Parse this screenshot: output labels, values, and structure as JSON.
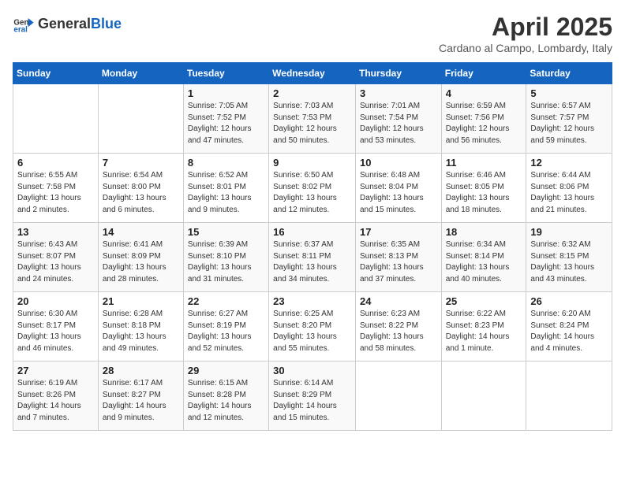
{
  "header": {
    "logo_general": "General",
    "logo_blue": "Blue",
    "title": "April 2025",
    "subtitle": "Cardano al Campo, Lombardy, Italy"
  },
  "weekdays": [
    "Sunday",
    "Monday",
    "Tuesday",
    "Wednesday",
    "Thursday",
    "Friday",
    "Saturday"
  ],
  "weeks": [
    [
      {
        "day": "",
        "info": ""
      },
      {
        "day": "",
        "info": ""
      },
      {
        "day": "1",
        "info": "Sunrise: 7:05 AM\nSunset: 7:52 PM\nDaylight: 12 hours and 47 minutes."
      },
      {
        "day": "2",
        "info": "Sunrise: 7:03 AM\nSunset: 7:53 PM\nDaylight: 12 hours and 50 minutes."
      },
      {
        "day": "3",
        "info": "Sunrise: 7:01 AM\nSunset: 7:54 PM\nDaylight: 12 hours and 53 minutes."
      },
      {
        "day": "4",
        "info": "Sunrise: 6:59 AM\nSunset: 7:56 PM\nDaylight: 12 hours and 56 minutes."
      },
      {
        "day": "5",
        "info": "Sunrise: 6:57 AM\nSunset: 7:57 PM\nDaylight: 12 hours and 59 minutes."
      }
    ],
    [
      {
        "day": "6",
        "info": "Sunrise: 6:55 AM\nSunset: 7:58 PM\nDaylight: 13 hours and 2 minutes."
      },
      {
        "day": "7",
        "info": "Sunrise: 6:54 AM\nSunset: 8:00 PM\nDaylight: 13 hours and 6 minutes."
      },
      {
        "day": "8",
        "info": "Sunrise: 6:52 AM\nSunset: 8:01 PM\nDaylight: 13 hours and 9 minutes."
      },
      {
        "day": "9",
        "info": "Sunrise: 6:50 AM\nSunset: 8:02 PM\nDaylight: 13 hours and 12 minutes."
      },
      {
        "day": "10",
        "info": "Sunrise: 6:48 AM\nSunset: 8:04 PM\nDaylight: 13 hours and 15 minutes."
      },
      {
        "day": "11",
        "info": "Sunrise: 6:46 AM\nSunset: 8:05 PM\nDaylight: 13 hours and 18 minutes."
      },
      {
        "day": "12",
        "info": "Sunrise: 6:44 AM\nSunset: 8:06 PM\nDaylight: 13 hours and 21 minutes."
      }
    ],
    [
      {
        "day": "13",
        "info": "Sunrise: 6:43 AM\nSunset: 8:07 PM\nDaylight: 13 hours and 24 minutes."
      },
      {
        "day": "14",
        "info": "Sunrise: 6:41 AM\nSunset: 8:09 PM\nDaylight: 13 hours and 28 minutes."
      },
      {
        "day": "15",
        "info": "Sunrise: 6:39 AM\nSunset: 8:10 PM\nDaylight: 13 hours and 31 minutes."
      },
      {
        "day": "16",
        "info": "Sunrise: 6:37 AM\nSunset: 8:11 PM\nDaylight: 13 hours and 34 minutes."
      },
      {
        "day": "17",
        "info": "Sunrise: 6:35 AM\nSunset: 8:13 PM\nDaylight: 13 hours and 37 minutes."
      },
      {
        "day": "18",
        "info": "Sunrise: 6:34 AM\nSunset: 8:14 PM\nDaylight: 13 hours and 40 minutes."
      },
      {
        "day": "19",
        "info": "Sunrise: 6:32 AM\nSunset: 8:15 PM\nDaylight: 13 hours and 43 minutes."
      }
    ],
    [
      {
        "day": "20",
        "info": "Sunrise: 6:30 AM\nSunset: 8:17 PM\nDaylight: 13 hours and 46 minutes."
      },
      {
        "day": "21",
        "info": "Sunrise: 6:28 AM\nSunset: 8:18 PM\nDaylight: 13 hours and 49 minutes."
      },
      {
        "day": "22",
        "info": "Sunrise: 6:27 AM\nSunset: 8:19 PM\nDaylight: 13 hours and 52 minutes."
      },
      {
        "day": "23",
        "info": "Sunrise: 6:25 AM\nSunset: 8:20 PM\nDaylight: 13 hours and 55 minutes."
      },
      {
        "day": "24",
        "info": "Sunrise: 6:23 AM\nSunset: 8:22 PM\nDaylight: 13 hours and 58 minutes."
      },
      {
        "day": "25",
        "info": "Sunrise: 6:22 AM\nSunset: 8:23 PM\nDaylight: 14 hours and 1 minute."
      },
      {
        "day": "26",
        "info": "Sunrise: 6:20 AM\nSunset: 8:24 PM\nDaylight: 14 hours and 4 minutes."
      }
    ],
    [
      {
        "day": "27",
        "info": "Sunrise: 6:19 AM\nSunset: 8:26 PM\nDaylight: 14 hours and 7 minutes."
      },
      {
        "day": "28",
        "info": "Sunrise: 6:17 AM\nSunset: 8:27 PM\nDaylight: 14 hours and 9 minutes."
      },
      {
        "day": "29",
        "info": "Sunrise: 6:15 AM\nSunset: 8:28 PM\nDaylight: 14 hours and 12 minutes."
      },
      {
        "day": "30",
        "info": "Sunrise: 6:14 AM\nSunset: 8:29 PM\nDaylight: 14 hours and 15 minutes."
      },
      {
        "day": "",
        "info": ""
      },
      {
        "day": "",
        "info": ""
      },
      {
        "day": "",
        "info": ""
      }
    ]
  ]
}
